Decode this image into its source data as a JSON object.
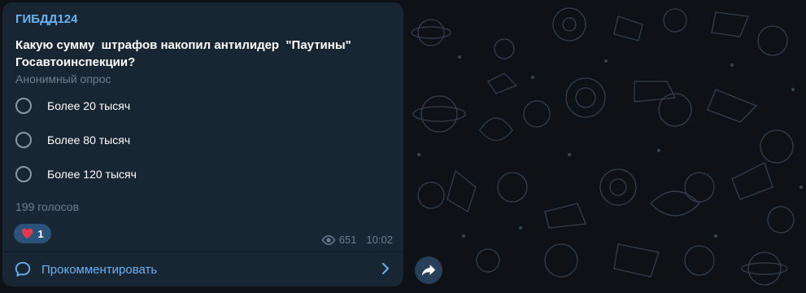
{
  "post": {
    "channel_name": "ГИБДД124",
    "question": "Какую сумму  штрафов накопил антилидер  \"Паутины\" Госавтоинспекции?",
    "poll_type": "Анонимный опрос",
    "options": [
      {
        "label": "Более 20 тысяч"
      },
      {
        "label": "Более 80 тысяч"
      },
      {
        "label": "Более 120 тысяч"
      }
    ],
    "votes_label": "199 голосов",
    "reaction": {
      "emoji": "heart",
      "count": "1"
    },
    "views": "651",
    "time": "10:02",
    "comment_label": "Прокомментировать"
  },
  "colors": {
    "bubble": "#182533",
    "accent": "#6ab3f3",
    "muted": "#6d7f8f",
    "reaction_bg": "#2b5278",
    "heart": "#e53a4e"
  },
  "icons": {
    "reaction": "heart-icon",
    "views": "eye-icon",
    "comment": "comment-bubble-icon",
    "chevron": "chevron-right-icon",
    "share": "share-arrow-icon"
  }
}
